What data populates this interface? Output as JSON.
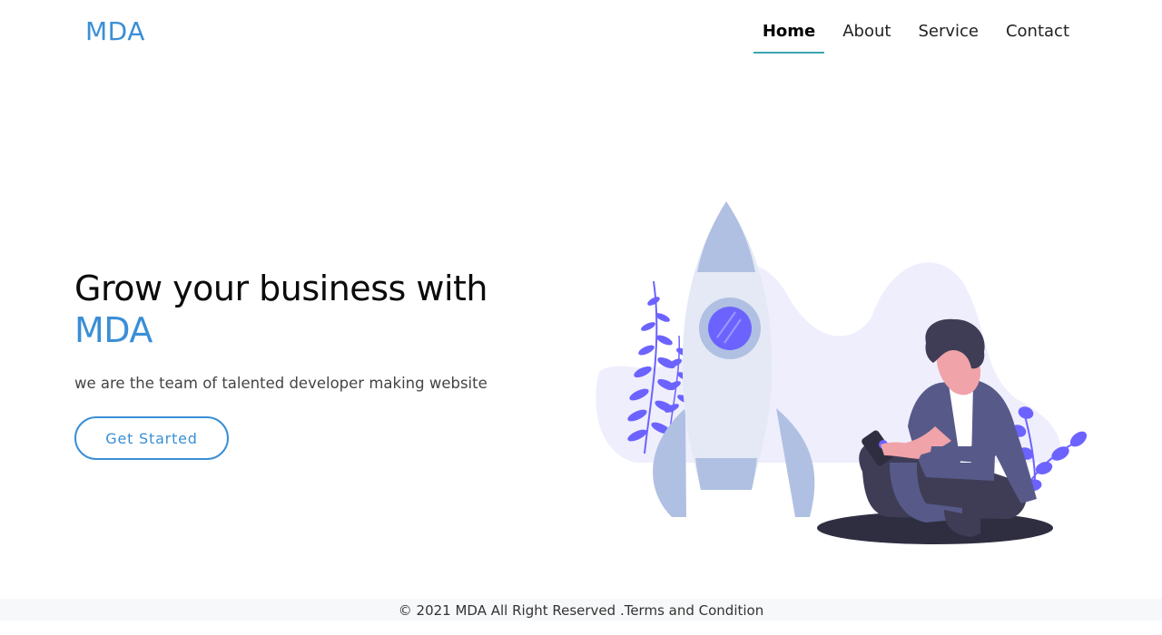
{
  "brand": {
    "name": "MDA"
  },
  "nav": {
    "items": [
      {
        "label": "Home",
        "active": true
      },
      {
        "label": "About",
        "active": false
      },
      {
        "label": "Service",
        "active": false
      },
      {
        "label": "Contact",
        "active": false
      }
    ]
  },
  "hero": {
    "title_line1": "Grow your business with",
    "title_brand": "MDA",
    "subtitle": "we are the team of talented developer making website",
    "cta_label": "Get Started"
  },
  "illustration": {
    "icon": "rocket-person-illustration",
    "colors": {
      "blob": "#efeefc",
      "rocket_body": "#e4e9f5",
      "rocket_fin": "#b0c0e2",
      "window": "#6c63ff",
      "plant": "#6c63ff",
      "shirt": "#575a89",
      "skin": "#f0a3a8",
      "shadow": "#2f2e41"
    }
  },
  "footer": {
    "text": "© 2021 MDA All Right Reserved .",
    "link": "Terms and Condition"
  },
  "theme": {
    "accent": "#3a8fd6",
    "underline": "#3aa6b0"
  }
}
